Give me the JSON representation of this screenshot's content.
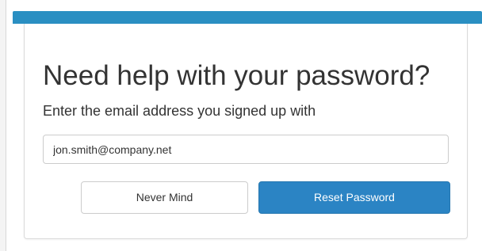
{
  "form": {
    "title": "Need help with your password?",
    "subtitle": "Enter the email address you signed up with",
    "email_value": "jon.smith@company.net"
  },
  "actions": {
    "cancel_label": "Never Mind",
    "submit_label": "Reset Password"
  },
  "colors": {
    "accent": "#2a8fc2",
    "primary_button": "#2b84c4",
    "text": "#333333",
    "border": "#cccccc"
  }
}
